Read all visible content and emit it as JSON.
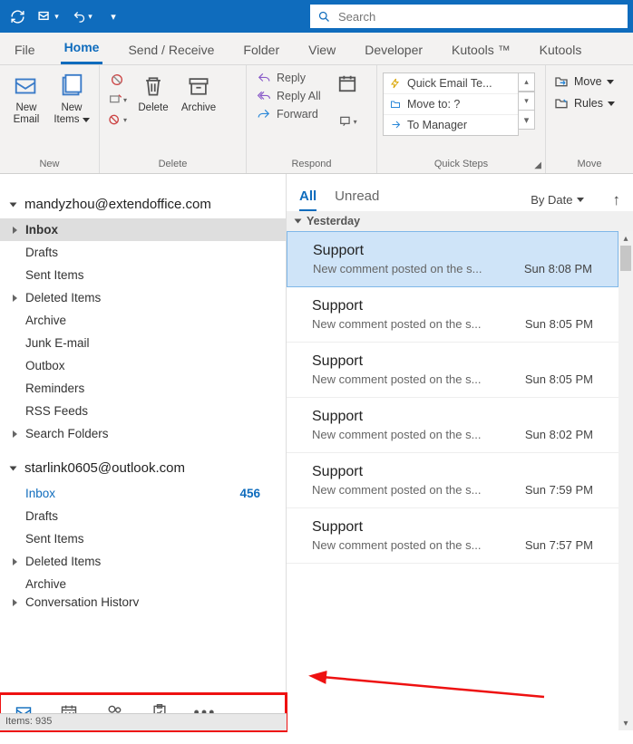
{
  "titlebar": {
    "search_placeholder": "Search"
  },
  "tabs": {
    "file": "File",
    "home": "Home",
    "sendrecv": "Send / Receive",
    "folder": "Folder",
    "view": "View",
    "developer": "Developer",
    "kutoolstm": "Kutools ™",
    "kutools": "Kutools"
  },
  "ribbon": {
    "new": {
      "label": "New",
      "new_email": "New Email",
      "new_items": "New Items"
    },
    "delete": {
      "label": "Delete",
      "delete": "Delete",
      "archive": "Archive"
    },
    "respond": {
      "label": "Respond",
      "reply": "Reply",
      "reply_all": "Reply All",
      "forward": "Forward"
    },
    "quicksteps": {
      "label": "Quick Steps",
      "items": [
        "Quick Email Te...",
        "Move to: ?",
        "To Manager"
      ]
    },
    "move": {
      "label": "Move",
      "move": "Move",
      "rules": "Rules"
    }
  },
  "folders": {
    "accounts": [
      {
        "email": "mandyzhou@extendoffice.com",
        "folders": [
          {
            "name": "Inbox",
            "selected": true,
            "expandable": true
          },
          {
            "name": "Drafts"
          },
          {
            "name": "Sent Items"
          },
          {
            "name": "Deleted Items",
            "expandable": true
          },
          {
            "name": "Archive"
          },
          {
            "name": "Junk E-mail"
          },
          {
            "name": "Outbox"
          },
          {
            "name": "Reminders"
          },
          {
            "name": "RSS Feeds"
          },
          {
            "name": "Search Folders",
            "expandable": true
          }
        ]
      },
      {
        "email": "starlink0605@outlook.com",
        "folders": [
          {
            "name": "Inbox",
            "count": "456",
            "link": true
          },
          {
            "name": "Drafts"
          },
          {
            "name": "Sent Items"
          },
          {
            "name": "Deleted Items",
            "expandable": true
          },
          {
            "name": "Archive"
          },
          {
            "name": "Conversation History",
            "expandable": true,
            "cut": true
          }
        ]
      }
    ]
  },
  "messages": {
    "filter_all": "All",
    "filter_unread": "Unread",
    "sort": "By Date",
    "group": "Yesterday",
    "items": [
      {
        "from": "Support",
        "subject": "New comment posted on the s...",
        "date": "Sun 8:08 PM",
        "selected": true
      },
      {
        "from": "Support",
        "subject": "New comment posted on the s...",
        "date": "Sun 8:05 PM"
      },
      {
        "from": "Support",
        "subject": "New comment posted on the s...",
        "date": "Sun 8:05 PM"
      },
      {
        "from": "Support",
        "subject": "New comment posted on the s...",
        "date": "Sun 8:02 PM"
      },
      {
        "from": "Support",
        "subject": "New comment posted on the s...",
        "date": "Sun 7:59 PM"
      },
      {
        "from": "Support",
        "subject": "New comment posted on the s...",
        "date": "Sun 7:57 PM"
      }
    ]
  },
  "status": {
    "items": "Items: 935"
  }
}
